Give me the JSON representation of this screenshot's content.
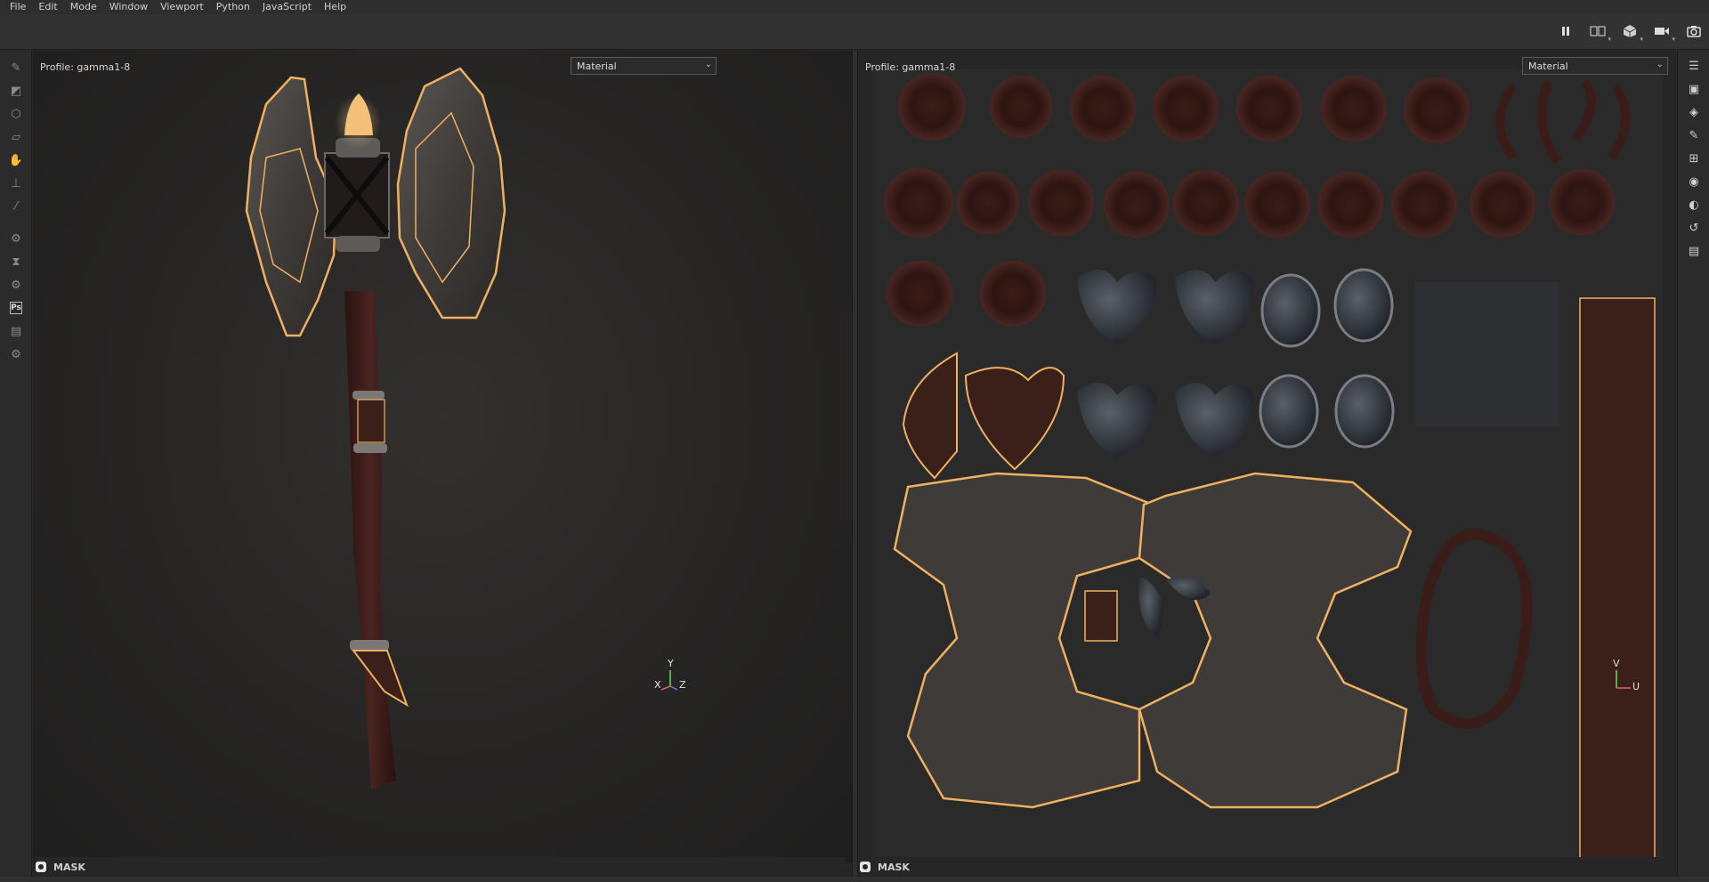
{
  "menu": [
    "File",
    "Edit",
    "Mode",
    "Window",
    "Viewport",
    "Python",
    "JavaScript",
    "Help"
  ],
  "toolbar": {
    "icons": [
      "pause-icon",
      "split-view-icon",
      "cube-view-icon",
      "camera-icon",
      "screenshot-icon"
    ]
  },
  "left_tools": [
    "paint-brush-icon",
    "eraser-icon",
    "projection-icon",
    "polygon-fill-icon",
    "smudge-icon",
    "clone-stamp-icon",
    "color-picker-icon",
    "bake-settings-icon",
    "hourglass-icon",
    "settings-icon",
    "photoshop-export-icon",
    "export-icon",
    "plugin-icon"
  ],
  "ps_label": "Ps",
  "right_tools": [
    "texture-set-list-icon",
    "texture-set-settings-icon",
    "layers-icon",
    "properties-icon",
    "display-settings-icon",
    "viewer-settings-icon",
    "shader-settings-icon",
    "history-icon",
    "log-icon"
  ],
  "viewport3d": {
    "profile": "Profile: gamma1-8",
    "mode": "Material",
    "axis_y": "Y",
    "axis_x": "X",
    "axis_z": "Z"
  },
  "viewport2d": {
    "profile": "Profile: gamma1-8",
    "mode": "Material",
    "axis_v": "V",
    "axis_u": "U"
  },
  "status_left": "MASK",
  "status_right": "MASK",
  "colors": {
    "glow": "#f0b060",
    "metal": "#4a4848",
    "leather": "#3a1c18"
  }
}
